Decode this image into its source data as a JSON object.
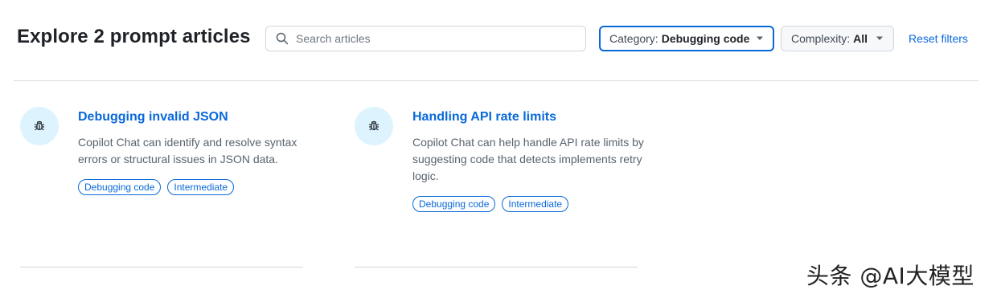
{
  "header": {
    "title": "Explore 2 prompt articles"
  },
  "search": {
    "placeholder": "Search articles",
    "value": ""
  },
  "filters": {
    "category_label": "Category:",
    "category_value": "Debugging code",
    "complexity_label": "Complexity:",
    "complexity_value": "All",
    "reset_label": "Reset filters"
  },
  "articles": [
    {
      "title": "Debugging invalid JSON",
      "description": "Copilot Chat can identify and resolve syntax errors or structural issues in JSON data.",
      "icon": "bug-icon",
      "tags": [
        "Debugging code",
        "Intermediate"
      ]
    },
    {
      "title": "Handling API rate limits",
      "description": "Copilot Chat can help handle API rate limits by suggesting code that detects implements retry logic.",
      "icon": "bug-icon",
      "tags": [
        "Debugging code",
        "Intermediate"
      ]
    }
  ],
  "watermark": "头条 @AI大模型",
  "colors": {
    "accent": "#0969da",
    "icon_bg": "#ddf4ff",
    "border": "#d0d7de"
  }
}
